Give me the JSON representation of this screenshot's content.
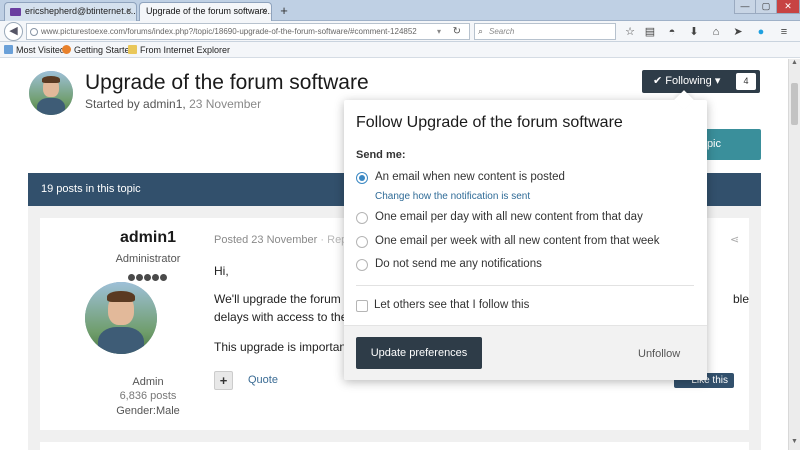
{
  "browser": {
    "tabs": [
      {
        "label": "ericshepherd@btinternet.c...",
        "close": "×"
      },
      {
        "label": "Upgrade of the forum software...",
        "close": "×"
      }
    ],
    "new_tab": "+",
    "window_controls": {
      "minimize": "—",
      "maximize": "▢",
      "close": "✕"
    },
    "url": "www.picturestoexe.com/forums/index.php?/topic/18690-upgrade-of-the-forum-software/#comment-124852",
    "search_placeholder": "Search",
    "toolbar_icons": [
      "star-icon",
      "reading-list-icon",
      "pocket-icon",
      "download-icon",
      "home-icon",
      "send-icon",
      "skype-icon",
      "menu-icon"
    ],
    "bookmarks": [
      {
        "label": "Most Visited",
        "icon": "bookmark-star-icon"
      },
      {
        "label": "Getting Started",
        "icon": "firefox-icon"
      },
      {
        "label": "From Internet Explorer",
        "icon": "folder-icon"
      }
    ]
  },
  "topic": {
    "title": "Upgrade of the forum software",
    "started_by_prefix": "Started by ",
    "author_link": "admin1",
    "date": "23 November"
  },
  "follow": {
    "label": "Following",
    "count": "4"
  },
  "reply_button": {
    "label": "pic"
  },
  "posts_bar": {
    "label": "19 posts in this topic"
  },
  "post": {
    "author": "admin1",
    "role": "Administrator",
    "group": "Admin",
    "post_count": "6,836 posts",
    "gender": "Gender:Male",
    "posted": "Posted 23 November",
    "report": " · Repo",
    "greeting": "Hi,",
    "line1": "We'll upgrade the forum so",
    "line1_end": "ble",
    "line2": "delays with access to the",
    "line3": "This upgrade is important",
    "quote": "Quote",
    "like": "Like this"
  },
  "popup": {
    "title": "Follow Upgrade of the forum software",
    "send_me": "Send me:",
    "options": [
      {
        "label": "An email when new content is posted",
        "selected": true
      },
      {
        "label": "One email per day with all new content from that day",
        "selected": false
      },
      {
        "label": "One email per week with all new content from that week",
        "selected": false
      },
      {
        "label": "Do not send me any notifications",
        "selected": false
      }
    ],
    "change_link": "Change how the notification is sent",
    "anonymous_label": "Let others see that I follow this",
    "update_button": "Update preferences",
    "unfollow": "Unfollow"
  },
  "colors": {
    "dark": "#2e3c48",
    "posts_bar": "#32506c",
    "teal": "#3a8f9b",
    "link": "#2f6b97",
    "radio_selected": "#3b88c3"
  }
}
